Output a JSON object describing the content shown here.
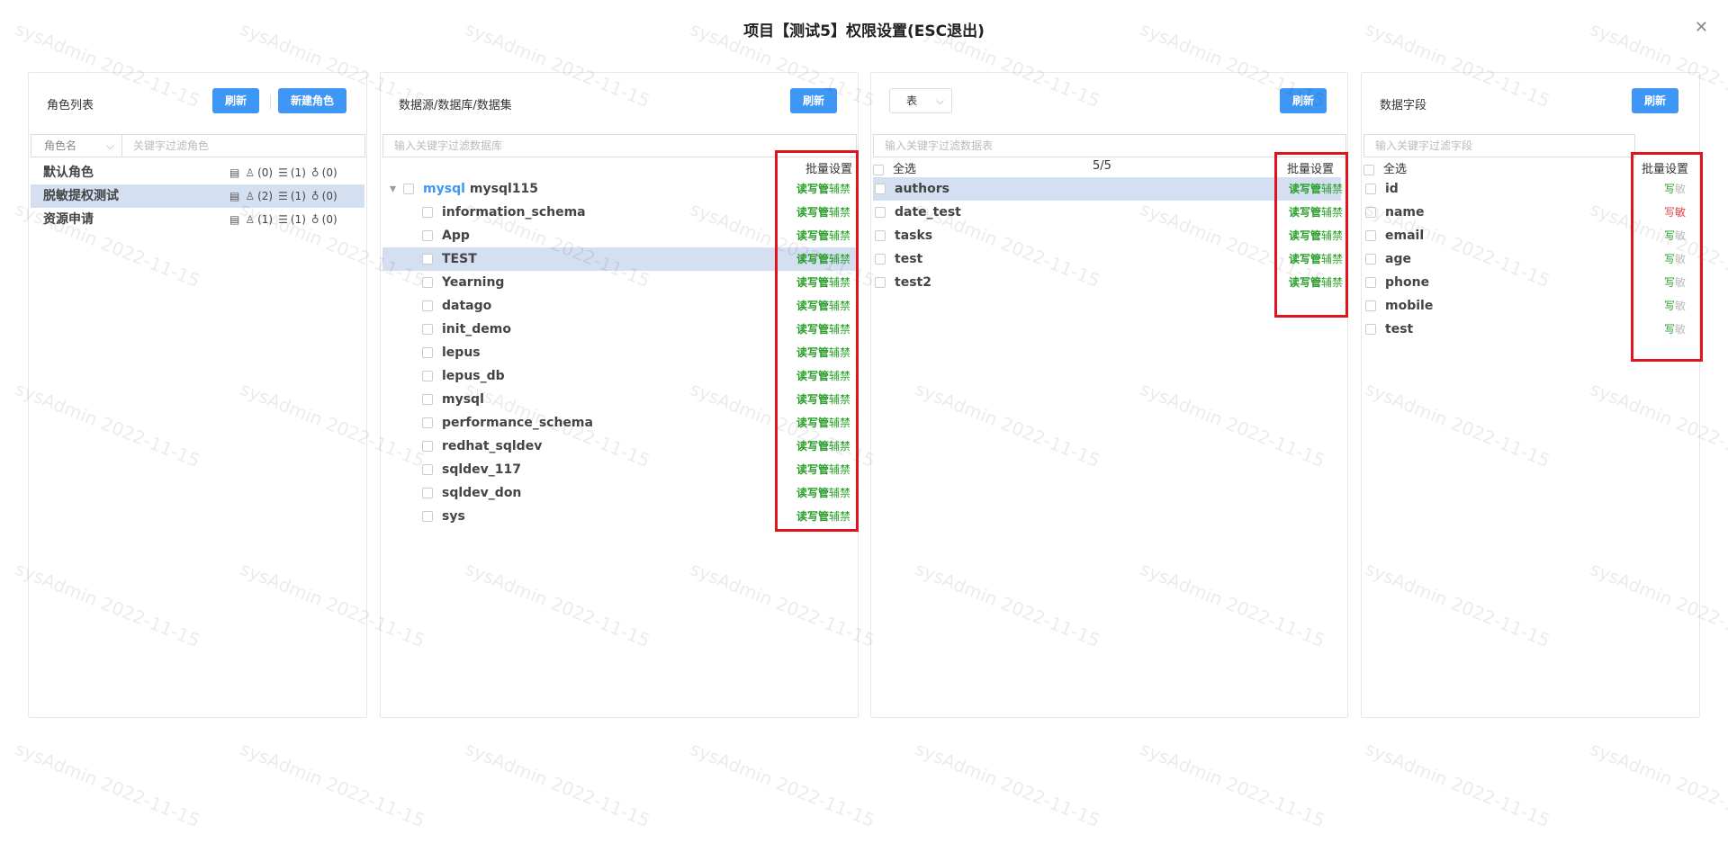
{
  "dialog": {
    "title": "项目【测试5】权限设置(ESC退出)",
    "close_icon": "✕"
  },
  "watermark": "sysAdmin 2022-11-15",
  "roles": {
    "header": "角色列表",
    "refresh": "刷新",
    "new_role": "新建角色",
    "filter_select": "角色名",
    "filter_placeholder": "关键字过滤角色",
    "items": [
      {
        "name": "默认角色",
        "users": "(0)",
        "dbs": "(1)",
        "ideas": "(0)"
      },
      {
        "name": "脱敏提权测试",
        "users": "(2)",
        "dbs": "(1)",
        "ideas": "(0)"
      },
      {
        "name": "资源申请",
        "users": "(1)",
        "dbs": "(1)",
        "ideas": "(0)"
      }
    ]
  },
  "dbs": {
    "header": "数据源/数据库/数据集",
    "refresh": "刷新",
    "filter_placeholder": "输入关键字过滤数据库",
    "batch": "批量设置",
    "source_type": "mysql",
    "source_name": "mysql115",
    "perm": [
      "读写管",
      "辅禁"
    ],
    "items": [
      "information_schema",
      "App",
      "TEST",
      "Yearning",
      "datago",
      "init_demo",
      "lepus",
      "lepus_db",
      "mysql",
      "performance_schema",
      "redhat_sqldev",
      "sqldev_117",
      "sqldev_don",
      "sys"
    ]
  },
  "tables": {
    "select": "表",
    "refresh": "刷新",
    "filter_placeholder": "输入关键字过滤数据表",
    "select_all": "全选",
    "count": "5/5",
    "batch": "批量设置",
    "perm": [
      "读写管",
      "辅禁"
    ],
    "items": [
      "authors",
      "date_test",
      "tasks",
      "test",
      "test2"
    ]
  },
  "fields": {
    "header": "数据字段",
    "refresh": "刷新",
    "filter_placeholder": "输入关键字过滤字段",
    "select_all": "全选",
    "batch": "批量设置",
    "items": [
      {
        "name": "id",
        "w": "写",
        "s": "敏",
        "state": "normal"
      },
      {
        "name": "name",
        "w": "写",
        "s": "敏",
        "state": "sensitive"
      },
      {
        "name": "email",
        "w": "写",
        "s": "敏",
        "state": "normal"
      },
      {
        "name": "age",
        "w": "写",
        "s": "敏",
        "state": "normal"
      },
      {
        "name": "phone",
        "w": "写",
        "s": "敏",
        "state": "normal"
      },
      {
        "name": "mobile",
        "w": "写",
        "s": "敏",
        "state": "normal"
      },
      {
        "name": "test",
        "w": "写",
        "s": "敏",
        "state": "normal"
      }
    ]
  }
}
